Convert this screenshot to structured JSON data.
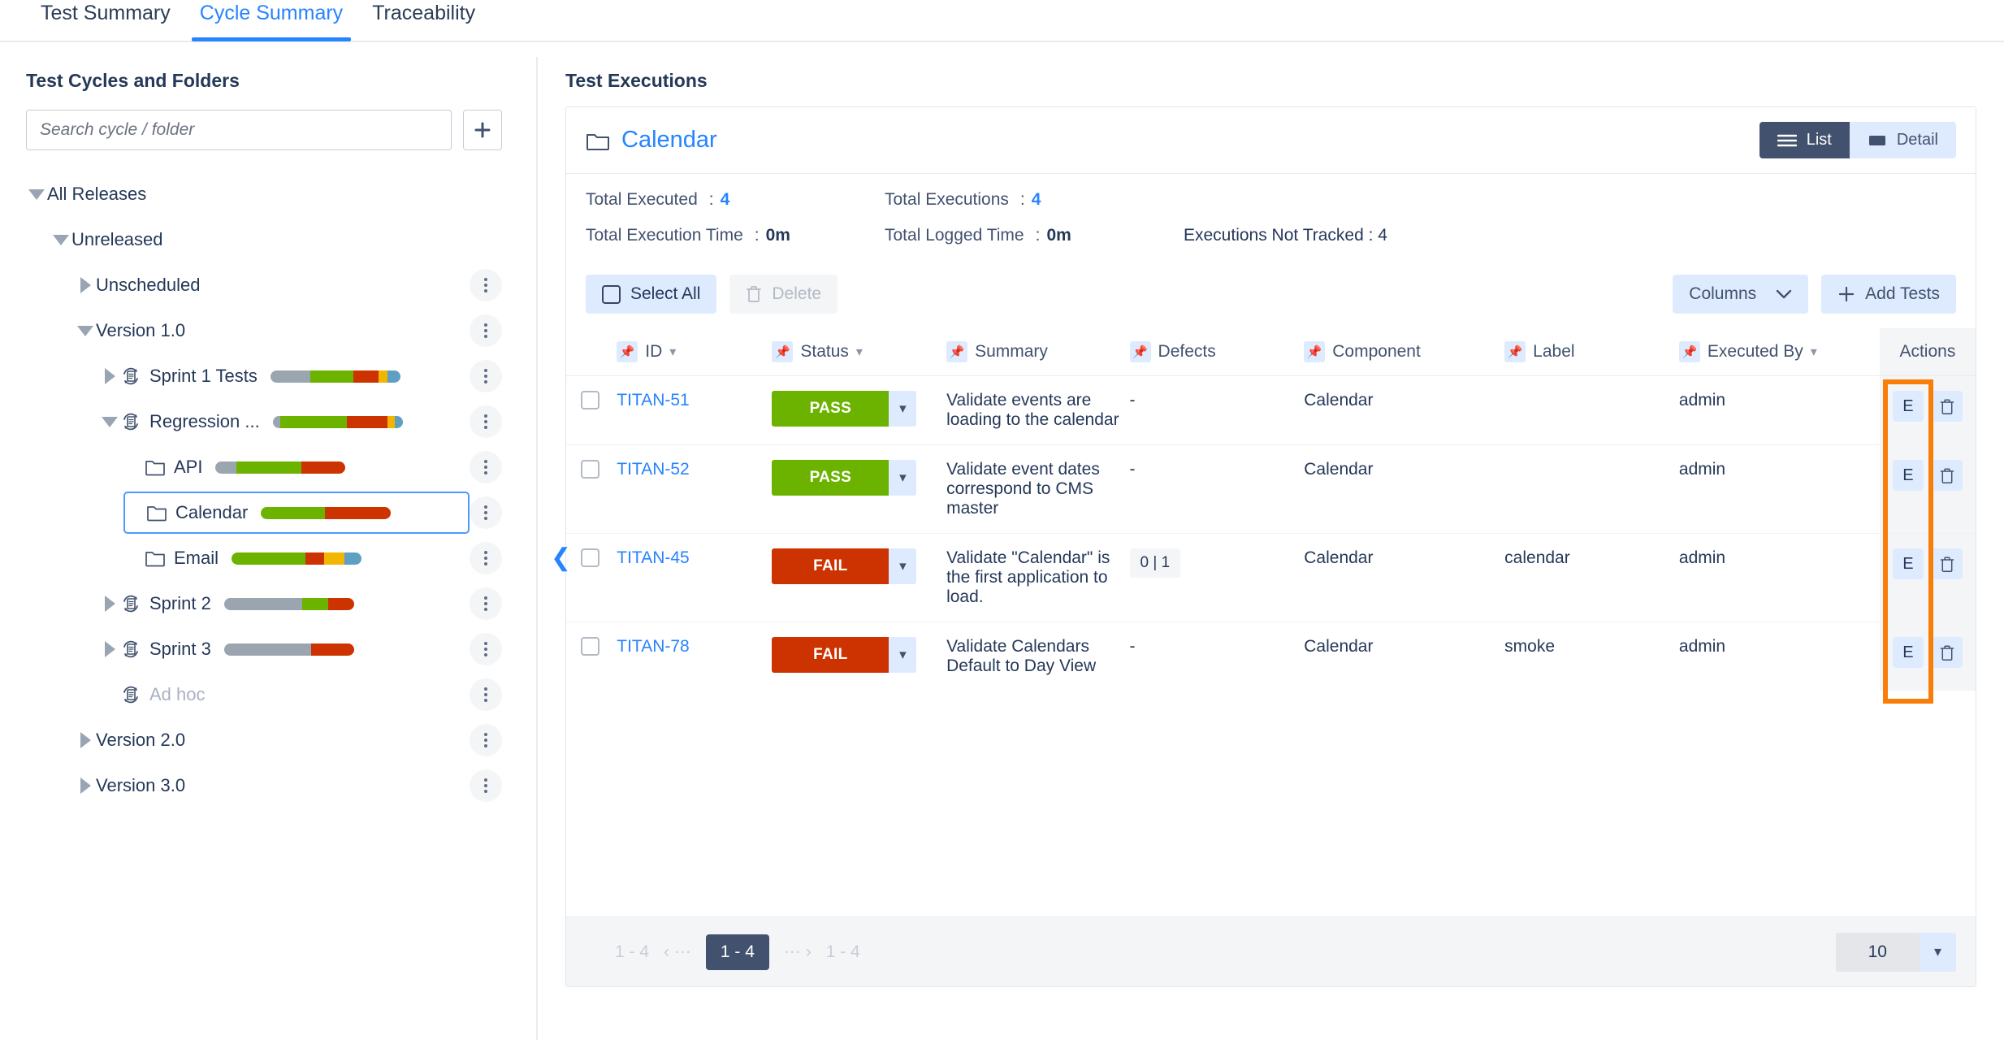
{
  "tabs": [
    {
      "label": "Test Summary",
      "active": false
    },
    {
      "label": "Cycle Summary",
      "active": true
    },
    {
      "label": "Traceability",
      "active": false
    }
  ],
  "sidebar": {
    "title": "Test Cycles and Folders",
    "search_placeholder": "Search cycle / folder",
    "add_label": "+",
    "tree": [
      {
        "label": "All Releases",
        "indent": 0,
        "caret": "down",
        "icon": "none",
        "bar": null,
        "kebab": false,
        "selected": false,
        "muted": false
      },
      {
        "label": "Unreleased",
        "indent": 1,
        "caret": "down",
        "icon": "none",
        "bar": null,
        "kebab": false,
        "selected": false,
        "muted": false
      },
      {
        "label": "Unscheduled",
        "indent": 2,
        "caret": "right",
        "icon": "none",
        "bar": null,
        "kebab": true,
        "selected": false,
        "muted": false
      },
      {
        "label": "Version 1.0",
        "indent": 2,
        "caret": "down",
        "icon": "none",
        "bar": null,
        "kebab": true,
        "selected": false,
        "muted": false
      },
      {
        "label": "Sprint 1 Tests",
        "indent": 3,
        "caret": "right",
        "icon": "cycle",
        "bar": [
          [
            "#9aa5b0",
            31
          ],
          [
            "#6cb300",
            33
          ],
          [
            "#cc3300",
            19
          ],
          [
            "#f2b500",
            7
          ],
          [
            "#5e9fc4",
            10
          ]
        ],
        "kebab": true,
        "selected": false,
        "muted": false
      },
      {
        "label": "Regression ...",
        "indent": 3,
        "caret": "down",
        "icon": "cycle",
        "bar": [
          [
            "#9aa5b0",
            6
          ],
          [
            "#6cb300",
            51
          ],
          [
            "#cc3300",
            31
          ],
          [
            "#f2b500",
            6
          ],
          [
            "#5e9fc4",
            6
          ]
        ],
        "kebab": true,
        "selected": false,
        "muted": false
      },
      {
        "label": "API",
        "indent": 4,
        "caret": "none",
        "icon": "folder",
        "bar": [
          [
            "#9aa5b0",
            16
          ],
          [
            "#6cb300",
            50
          ],
          [
            "#cc3300",
            34
          ]
        ],
        "kebab": true,
        "selected": false,
        "muted": false
      },
      {
        "label": "Calendar",
        "indent": 4,
        "caret": "none",
        "icon": "folder",
        "bar": [
          [
            "#6cb300",
            49
          ],
          [
            "#cc3300",
            51
          ]
        ],
        "kebab": true,
        "selected": true,
        "muted": false
      },
      {
        "label": "Email",
        "indent": 4,
        "caret": "none",
        "icon": "folder",
        "bar": [
          [
            "#6cb300",
            57
          ],
          [
            "#cc3300",
            14
          ],
          [
            "#f2b500",
            16
          ],
          [
            "#5e9fc4",
            13
          ]
        ],
        "kebab": true,
        "selected": false,
        "muted": false
      },
      {
        "label": "Sprint 2",
        "indent": 3,
        "caret": "right",
        "icon": "cycle",
        "bar": [
          [
            "#9aa5b0",
            60
          ],
          [
            "#6cb300",
            20
          ],
          [
            "#cc3300",
            20
          ]
        ],
        "kebab": true,
        "selected": false,
        "muted": false
      },
      {
        "label": "Sprint 3",
        "indent": 3,
        "caret": "right",
        "icon": "cycle",
        "bar": [
          [
            "#9aa5b0",
            67
          ],
          [
            "#cc3300",
            33
          ]
        ],
        "kebab": true,
        "selected": false,
        "muted": false
      },
      {
        "label": "Ad hoc",
        "indent": 3,
        "caret": "none",
        "icon": "cycle",
        "bar": null,
        "kebab": true,
        "selected": false,
        "muted": true
      },
      {
        "label": "Version 2.0",
        "indent": 2,
        "caret": "right",
        "icon": "none",
        "bar": null,
        "kebab": true,
        "selected": false,
        "muted": false
      },
      {
        "label": "Version 3.0",
        "indent": 2,
        "caret": "right",
        "icon": "none",
        "bar": null,
        "kebab": true,
        "selected": false,
        "muted": false
      }
    ]
  },
  "main": {
    "title": "Test Executions",
    "folder_name": "Calendar",
    "view_toggle": {
      "list_label": "List",
      "detail_label": "Detail",
      "active": "List"
    },
    "stats": {
      "total_executed_key": "Total Executed",
      "total_executed_value": "4",
      "total_executions_key": "Total Executions",
      "total_executions_value": "4",
      "total_execution_time_key": "Total Execution Time",
      "total_execution_time_value": "0m",
      "total_logged_time_key": "Total Logged Time",
      "total_logged_time_value": "0m",
      "executions_not_tracked": "Executions Not Tracked :  4",
      "colon": ":"
    },
    "toolbar": {
      "select_all_label": "Select All",
      "delete_label": "Delete",
      "columns_label": "Columns",
      "add_tests_label": "Add Tests"
    },
    "table": {
      "headers": [
        {
          "label": "ID",
          "pin": true,
          "sort": true
        },
        {
          "label": "Status",
          "pin": true,
          "sort": true
        },
        {
          "label": "Summary",
          "pin": true,
          "sort": false
        },
        {
          "label": "Defects",
          "pin": true,
          "sort": false
        },
        {
          "label": "Component",
          "pin": true,
          "sort": false
        },
        {
          "label": "Label",
          "pin": true,
          "sort": false
        },
        {
          "label": "Executed By",
          "pin": true,
          "sort": true
        }
      ],
      "actions_header": "Actions",
      "rows": [
        {
          "id": "TITAN-51",
          "status": "PASS",
          "status_color": "#6cb300",
          "summary": "Validate events are loading to the calendar",
          "defects": "-",
          "defects_badge": false,
          "component": "Calendar",
          "label": "",
          "executed_by": "admin"
        },
        {
          "id": "TITAN-52",
          "status": "PASS",
          "status_color": "#6cb300",
          "summary": "Validate event dates correspond to CMS master",
          "defects": "-",
          "defects_badge": false,
          "component": "Calendar",
          "label": "",
          "executed_by": "admin"
        },
        {
          "id": "TITAN-45",
          "status": "FAIL",
          "status_color": "#cc3300",
          "summary": "Validate \"Calendar\" is the first application to load.",
          "defects": "0 | 1",
          "defects_badge": true,
          "component": "Calendar",
          "label": "calendar",
          "executed_by": "admin"
        },
        {
          "id": "TITAN-78",
          "status": "FAIL",
          "status_color": "#cc3300",
          "summary": "Validate Calendars Default to Day View",
          "defects": "-",
          "defects_badge": false,
          "component": "Calendar",
          "label": "smoke",
          "executed_by": "admin"
        }
      ],
      "row_action_edit": "E",
      "row_action_delete": "trash-icon"
    },
    "pagination": {
      "left_label": "1 - 4",
      "prev_group": "‹ ⋯",
      "current": "1 - 4",
      "next_group": "⋯ ›",
      "right_label": "1 - 4",
      "page_size": "10"
    }
  },
  "colors": {
    "accent_blue": "#2684ff",
    "pass_green": "#6cb300",
    "fail_red": "#cc3300",
    "wip_yellow": "#f2b500",
    "blocked_blue": "#5e9fc4",
    "unexecuted_gray": "#9aa5b0",
    "highlight_orange": "#f97d09",
    "dark_slate": "#42526e"
  }
}
